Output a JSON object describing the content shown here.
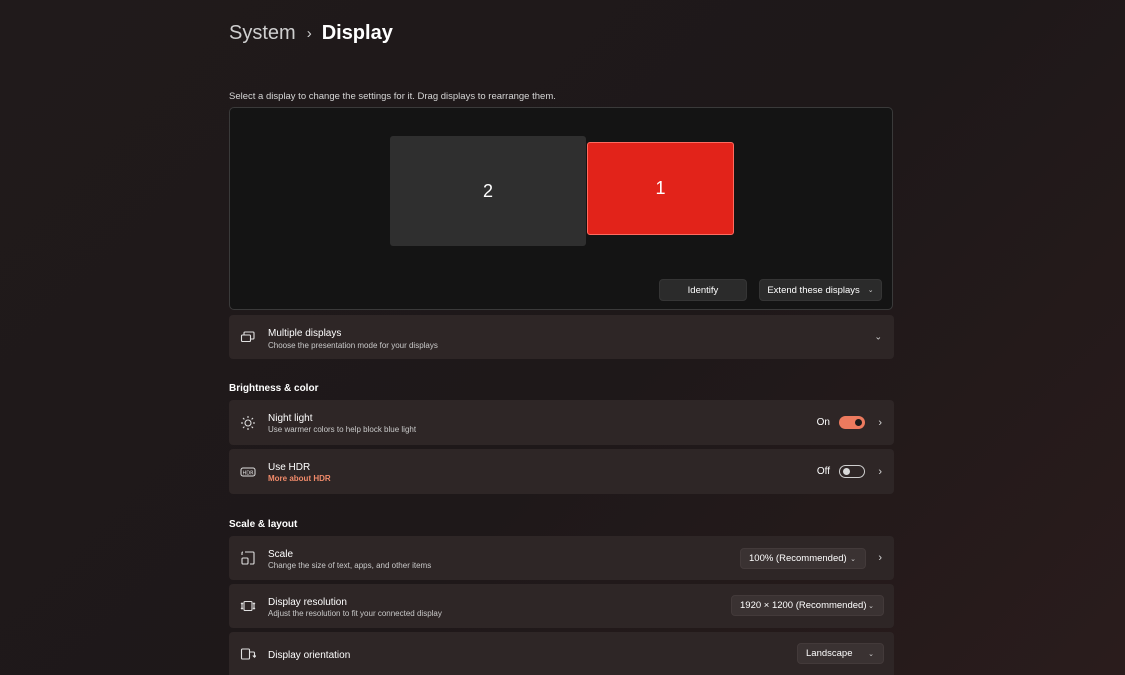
{
  "breadcrumb": {
    "parent": "System",
    "separator": "›",
    "current": "Display"
  },
  "instruction": "Select a display to change the settings for it. Drag displays to rearrange them.",
  "monitors": [
    {
      "label": "2"
    },
    {
      "label": "1",
      "selected": true
    }
  ],
  "buttons": {
    "identify": "Identify",
    "extend": "Extend these displays"
  },
  "multiple_displays": {
    "title": "Multiple displays",
    "subtitle": "Choose the presentation mode for your displays"
  },
  "sections": {
    "brightness": "Brightness & color",
    "scale_layout": "Scale & layout"
  },
  "night_light": {
    "title": "Night light",
    "subtitle": "Use warmer colors to help block blue light",
    "state": "On"
  },
  "hdr": {
    "title": "Use HDR",
    "link": "More about HDR",
    "state": "Off"
  },
  "scale": {
    "title": "Scale",
    "subtitle": "Change the size of text, apps, and other items",
    "value": "100% (Recommended)"
  },
  "resolution": {
    "title": "Display resolution",
    "subtitle": "Adjust the resolution to fit your connected display",
    "value": "1920 × 1200 (Recommended)"
  },
  "orientation": {
    "title": "Display orientation",
    "value": "Landscape"
  },
  "colors": {
    "accent": "#ec7a5e",
    "selected_monitor": "#e2231a",
    "link": "#f08a6a"
  }
}
